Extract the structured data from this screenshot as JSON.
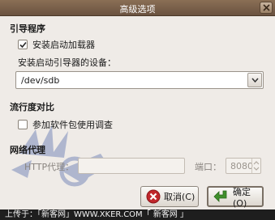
{
  "window": {
    "title": "高级选项"
  },
  "bootloader": {
    "section_title": "引导程序",
    "install_checkbox_label": "安装启动加载器",
    "install_checked": true,
    "device_label": "安装启动引导器的设备：",
    "device_value": "/dev/sdb"
  },
  "popularity": {
    "section_title": "流行度对比",
    "survey_checkbox_label": "参加软件包使用调查",
    "survey_checked": false
  },
  "proxy": {
    "section_title": "网络代理",
    "http_label": "HTTP代理：",
    "http_value": "",
    "port_label": "端口：",
    "port_value": "8080"
  },
  "buttons": {
    "cancel_label": "取消(C)",
    "ok_label": "确定(O)"
  },
  "footer": {
    "text": "上传于：「新客网」WWW.XKER.COM「 新客网 」"
  },
  "watermark": {
    "text": "1XKER.COM"
  },
  "colors": {
    "titlebar": "#7a6049",
    "window_bg": "#efebe7",
    "footer_bg": "#1e1e1e",
    "cancel_icon": "#c0262b",
    "ok_icon": "#3f8f2c"
  },
  "icons": [
    "close-icon",
    "checkmark-icon",
    "chevron-down-icon",
    "cancel-icon",
    "ok-arrow-icon"
  ]
}
